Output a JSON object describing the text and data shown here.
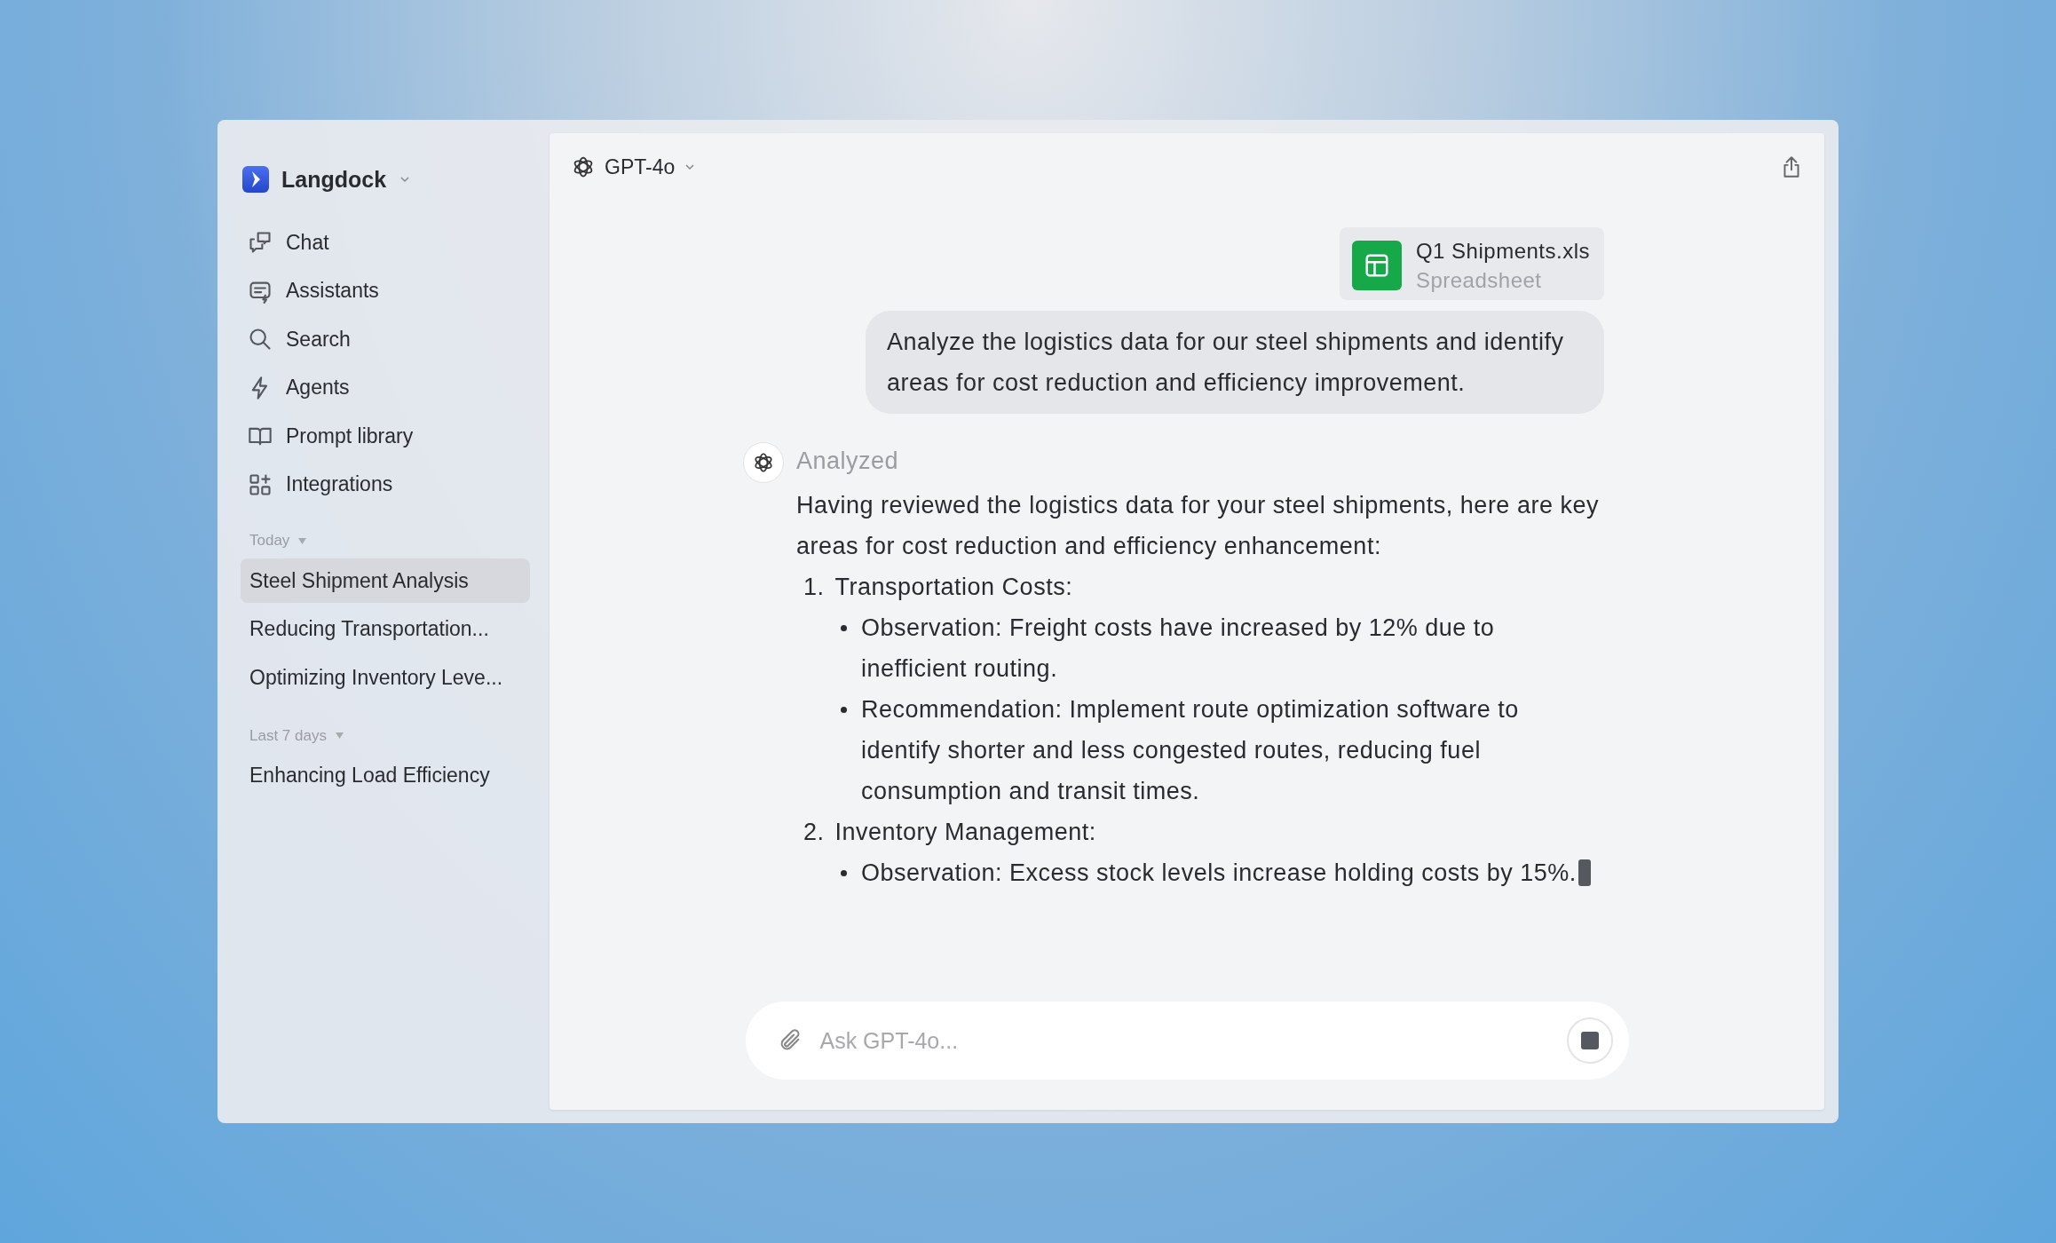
{
  "workspace": {
    "name": "Langdock"
  },
  "nav": [
    {
      "kind": "chat",
      "label": "Chat"
    },
    {
      "kind": "assistants",
      "label": "Assistants"
    },
    {
      "kind": "search",
      "label": "Search"
    },
    {
      "kind": "agents",
      "label": "Agents"
    },
    {
      "kind": "library",
      "label": "Prompt library"
    },
    {
      "kind": "integrations",
      "label": "Integrations"
    }
  ],
  "history": [
    {
      "heading": "Today",
      "chats": [
        {
          "title": "Steel Shipment Analysis",
          "selected": true
        },
        {
          "title": "Reducing Transportation...",
          "selected": false
        },
        {
          "title": "Optimizing Inventory Leve...",
          "selected": false
        }
      ]
    },
    {
      "heading": "Last 7 days",
      "chats": [
        {
          "title": "Enhancing Load Efficiency",
          "selected": false
        }
      ]
    }
  ],
  "model": "GPT-4o",
  "attachment": {
    "name": "Q1 Shipments.xls",
    "type": "Spreadsheet"
  },
  "user_message": "Analyze the logistics data for our steel shipments and identify areas for cost reduction and efficiency improvement.",
  "reply": {
    "status": "Analyzed",
    "intro": "Having reviewed the logistics data for your steel shipments, here are key areas for cost reduction and efficiency enhancement:",
    "streaming": true,
    "sections": [
      {
        "number": "1.",
        "title": "Transportation Costs:",
        "bullets": [
          "Observation: Freight costs have increased by 12% due to inefficient routing.",
          "Recommendation: Implement route optimization software to identify shorter and less congested routes, reducing fuel consumption and transit times."
        ]
      },
      {
        "number": "2.",
        "title": "Inventory Management:",
        "bullets": [
          "Observation: Excess stock levels increase holding costs by 15%."
        ]
      }
    ]
  },
  "composer": {
    "placeholder": "Ask GPT-4o..."
  }
}
